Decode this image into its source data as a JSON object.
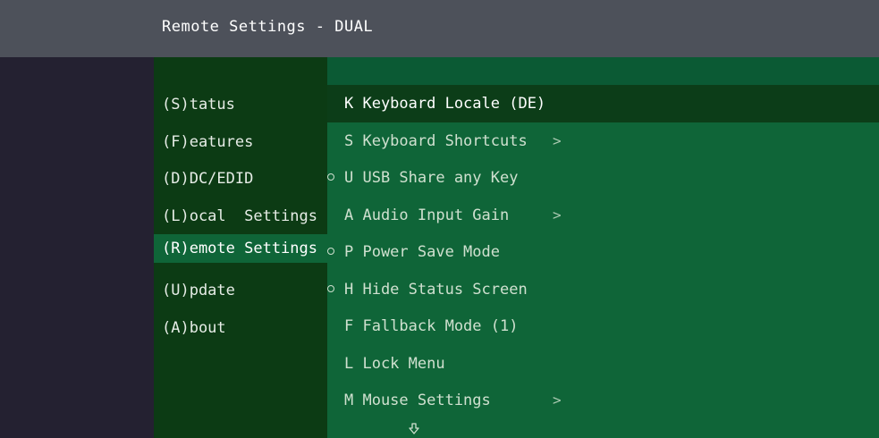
{
  "window": {
    "title": "Remote Settings - DUAL"
  },
  "categories": [
    {
      "label": "(S)tatus"
    },
    {
      "label": "(F)eatures"
    },
    {
      "label": "(D)DC/EDID"
    },
    {
      "label": "(L)ocal  Settings"
    },
    {
      "label": "(R)emote Settings",
      "active": true
    },
    {
      "label": "(U)pdate"
    },
    {
      "label": "(A)bout"
    }
  ],
  "options": [
    {
      "label": "K Keyboard Locale (DE)",
      "selected": true,
      "has_bullet": false,
      "has_submenu": false
    },
    {
      "label": "S Keyboard Shortcuts",
      "has_bullet": false,
      "has_submenu": true
    },
    {
      "label": "U USB Share any Key",
      "has_bullet": true,
      "has_submenu": false
    },
    {
      "label": "A Audio Input Gain",
      "has_bullet": false,
      "has_submenu": true
    },
    {
      "label": "P Power Save Mode",
      "has_bullet": true,
      "has_submenu": false
    },
    {
      "label": "H Hide Status Screen",
      "has_bullet": true,
      "has_submenu": false
    },
    {
      "label": "F Fallback Mode (1)",
      "has_bullet": false,
      "has_submenu": false
    },
    {
      "label": "L Lock Menu",
      "has_bullet": false,
      "has_submenu": false
    },
    {
      "label": "M Mouse Settings",
      "has_bullet": false,
      "has_submenu": true
    }
  ],
  "symbols": {
    "submenu": ">"
  },
  "icons": {
    "bullet": "circle-outline-icon",
    "submenu": "chevron-right-icon",
    "scroll_more": "arrow-down-icon"
  },
  "colors": {
    "background": "#242131",
    "titlebar": "#4d515a",
    "left_pane": "#0c3b14",
    "right_pane": "#0f6538",
    "selected_row": "#0c3d18"
  }
}
